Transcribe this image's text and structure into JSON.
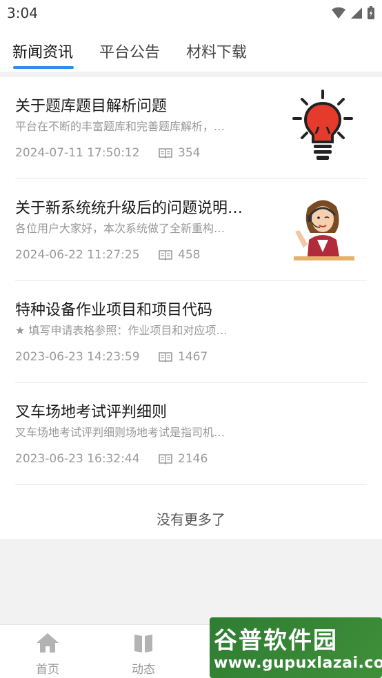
{
  "status_bar": {
    "time": "3:04"
  },
  "tabs": [
    {
      "label": "新闻资讯",
      "active": true
    },
    {
      "label": "平台公告",
      "active": false
    },
    {
      "label": "材料下载",
      "active": false
    }
  ],
  "colors": {
    "accent": "#2f8fe8",
    "watermark": "#2e7d32"
  },
  "news": [
    {
      "title": "关于题库题目解析问题",
      "summary": "平台在不断的丰富题库和完善题库解析，…",
      "date": "2024-07-11 17:50:12",
      "views": "354",
      "thumb_icon": "lightbulb-icon"
    },
    {
      "title": "关于新系统统升级后的问题说明…",
      "summary": "各位用户大家好，本次系统做了全新重构…",
      "date": "2024-06-22 11:27:25",
      "views": "458",
      "thumb_icon": "customer-service-icon"
    },
    {
      "title": "特种设备作业项目和项目代码",
      "summary": "★ 填写申请表格参照：作业项目和对应项…",
      "date": "2023-06-23 14:23:59",
      "views": "1467"
    },
    {
      "title": "叉车场地考试评判细则",
      "summary": "叉车场地考试评判细则场地考试是指司机…",
      "date": "2023-06-23 16:32:44",
      "views": "2146"
    }
  ],
  "footer": {
    "no_more": "没有更多了"
  },
  "bottom_nav": [
    {
      "label": "首页",
      "icon": "home-icon"
    },
    {
      "label": "动态",
      "icon": "book-icon"
    }
  ],
  "watermark": {
    "title": "谷普软件园",
    "url": "www.gupuxlazai.com"
  }
}
